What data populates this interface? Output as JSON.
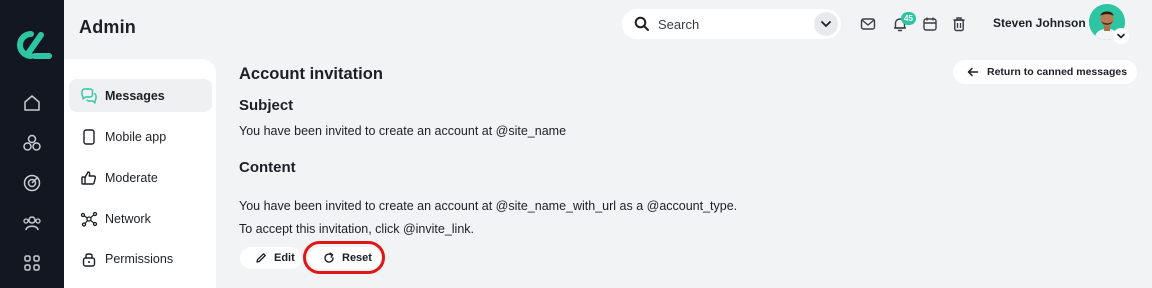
{
  "header": {
    "title": "Admin",
    "search": {
      "placeholder": "Search"
    },
    "notification_count": "45",
    "user_name": "Steven Johnson"
  },
  "rail": {
    "items": [
      "logo",
      "home-icon",
      "grid-objects-icon",
      "target-icon",
      "users-icon",
      "apps-icon"
    ]
  },
  "subnav": {
    "items": [
      {
        "label": "Messages",
        "icon": "chat-icon",
        "active": true
      },
      {
        "label": "Mobile app",
        "icon": "phone-icon"
      },
      {
        "label": "Moderate",
        "icon": "thumbs-up-icon"
      },
      {
        "label": "Network",
        "icon": "network-icon"
      },
      {
        "label": "Permissions",
        "icon": "lock-icon"
      }
    ]
  },
  "content": {
    "title": "Account invitation",
    "return_label": "Return to canned messages",
    "subject_heading": "Subject",
    "subject_text": "You have been invited to create an account at @site_name",
    "content_heading": "Content",
    "content_line1": "You have been invited to create an account at @site_name_with_url as a @account_type.",
    "content_line2": "To accept this invitation, click @invite_link.",
    "edit_label": "Edit",
    "reset_label": "Reset"
  },
  "colors": {
    "rail": "#121721",
    "accent": "#2ec5a3",
    "highlight": "#e01717",
    "background": "#f2f3f5"
  }
}
